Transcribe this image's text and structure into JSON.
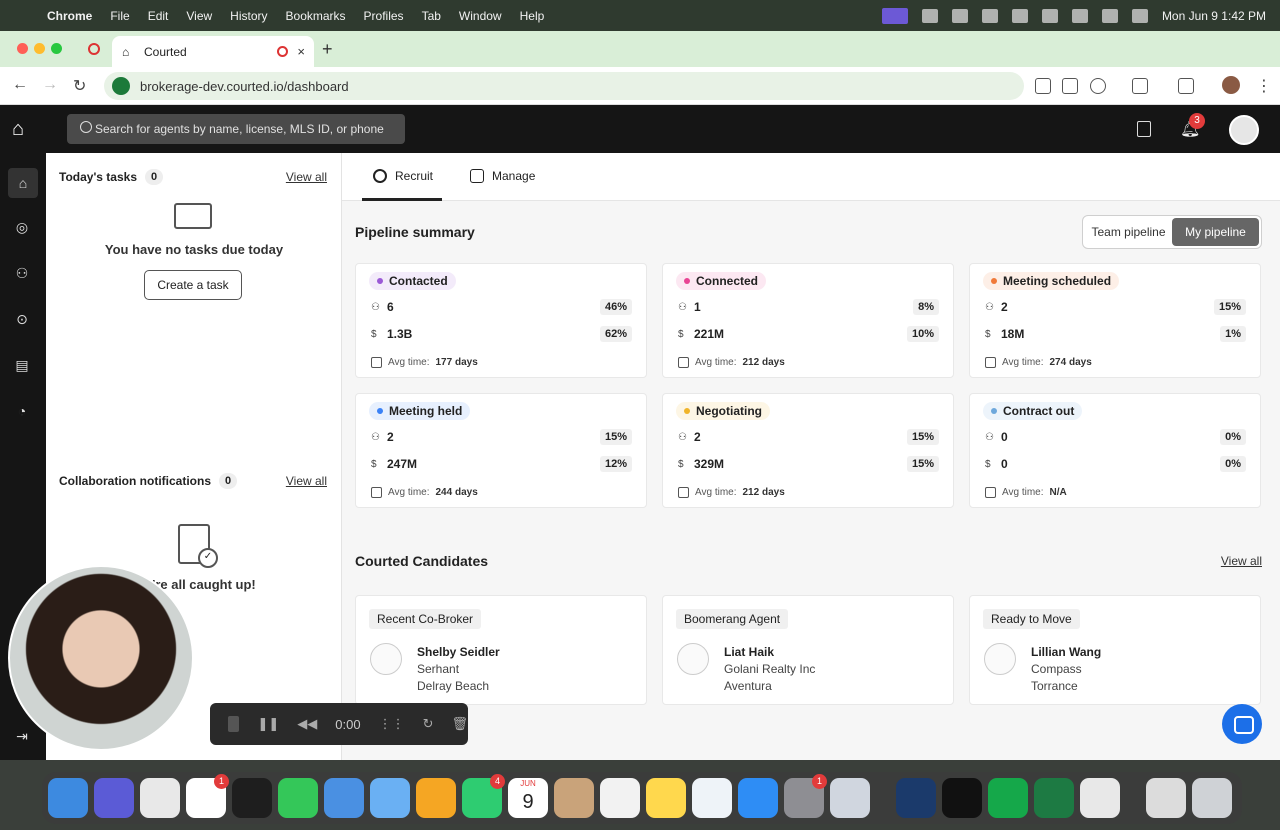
{
  "menubar": {
    "app": "Chrome",
    "items": [
      "File",
      "Edit",
      "View",
      "History",
      "Bookmarks",
      "Profiles",
      "Tab",
      "Window",
      "Help"
    ],
    "clock": "Mon Jun 9  1:42 PM"
  },
  "browser": {
    "tab_title": "Courted",
    "url": "brokerage-dev.courted.io/dashboard"
  },
  "header": {
    "search_placeholder": "Search for agents by name, license, MLS ID, or phone",
    "notification_count": "3"
  },
  "tasks": {
    "title": "Today's tasks",
    "count": "0",
    "view_all": "View all",
    "empty_text": "You have no tasks due today",
    "create_button": "Create a task"
  },
  "collab": {
    "title": "Collaboration notifications",
    "count": "0",
    "view_all": "View all",
    "empty_text": "'re all caught up!"
  },
  "subtabs": {
    "recruit": "Recruit",
    "manage": "Manage"
  },
  "pipeline": {
    "title": "Pipeline summary",
    "toggle": {
      "team": "Team pipeline",
      "mine": "My pipeline"
    },
    "avg_label": "Avg time:",
    "stages": [
      {
        "name": "Contacted",
        "color": "#9b59d6",
        "count": "6",
        "count_pct": "46%",
        "value": "1.3B",
        "value_pct": "62%",
        "avg": "177 days"
      },
      {
        "name": "Connected",
        "color": "#e84393",
        "count": "1",
        "count_pct": "8%",
        "value": "221M",
        "value_pct": "10%",
        "avg": "212 days"
      },
      {
        "name": "Meeting scheduled",
        "color": "#f07a3a",
        "count": "2",
        "count_pct": "15%",
        "value": "18M",
        "value_pct": "1%",
        "avg": "274 days"
      },
      {
        "name": "Meeting held",
        "color": "#3b82f6",
        "count": "2",
        "count_pct": "15%",
        "value": "247M",
        "value_pct": "12%",
        "avg": "244 days"
      },
      {
        "name": "Negotiating",
        "color": "#f0b429",
        "count": "2",
        "count_pct": "15%",
        "value": "329M",
        "value_pct": "15%",
        "avg": "212 days"
      },
      {
        "name": "Contract out",
        "color": "#6ea8dc",
        "count": "0",
        "count_pct": "0%",
        "value": "0",
        "value_pct": "0%",
        "avg": "N/A"
      }
    ]
  },
  "candidates": {
    "title": "Courted Candidates",
    "view_all": "View all",
    "items": [
      {
        "tag": "Recent Co-Broker",
        "name": "Shelby Seidler",
        "brokerage": "Serhant",
        "city": "Delray Beach"
      },
      {
        "tag": "Boomerang Agent",
        "name": "Liat Haik",
        "brokerage": "Golani Realty Inc",
        "city": "Aventura"
      },
      {
        "tag": "Ready to Move",
        "name": "Lillian Wang",
        "brokerage": "Compass",
        "city": "Torrance"
      }
    ]
  },
  "recorder": {
    "time": "0:00"
  },
  "dock_badges": {
    "slack": "1",
    "facetime": "4",
    "calendar_day": "9",
    "calendar_month": "JUN",
    "settings": "1"
  }
}
